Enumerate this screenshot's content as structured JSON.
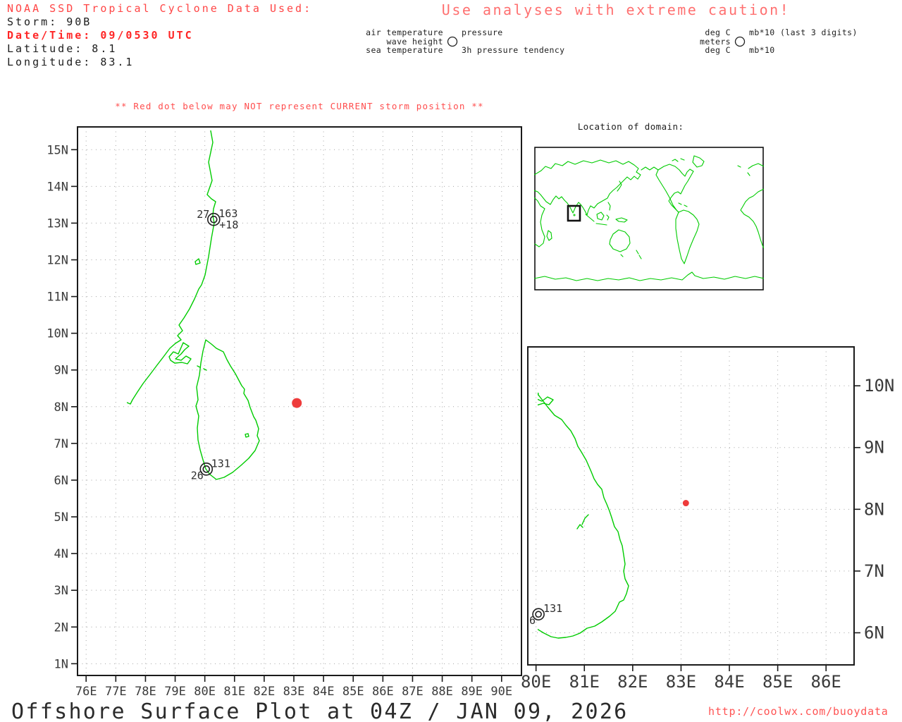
{
  "header": {
    "source_line": "NOAA SSD Tropical Cyclone Data Used:",
    "storm_line": "Storm: 90B",
    "datetime_line": "Date/Time: 09/0530 UTC",
    "latitude_line": "Latitude: 8.1",
    "longitude_line": "Longitude: 83.1",
    "caution": "Use analyses with extreme caution!"
  },
  "legend": {
    "air_label": "air temperature",
    "wave_label": "wave height",
    "sea_label": "sea temperature",
    "pressure_label": "pressure",
    "tendency_label": "3h pressure tendency",
    "air_unit": "deg C",
    "wave_unit": "meters",
    "sea_unit": "deg C",
    "pressure_unit": "mb*10 (last 3 digits)",
    "tendency_unit": "mb*10"
  },
  "warning": "** Red dot below may NOT represent CURRENT storm position **",
  "inset_title": "Location of domain:",
  "footer": {
    "title": "Offshore Surface Plot at 04Z / JAN 09, 2026",
    "url": "http://coolwx.com/buoydata"
  },
  "colors": {
    "coastline_green": "#00cc00",
    "storm_dot_red": "#ee3b3b",
    "warning_red": "#ff4d4d",
    "caution_red": "#ff7070",
    "header_red": "#ff4545",
    "datetime_red": "#ff2626",
    "url_red": "#ff5353",
    "grid_gray": "#a4a4a4",
    "axis_black": "#1a1a1a"
  },
  "chart_data": {
    "type": "map-observation-plot",
    "title": "Offshore Surface Plot at 04Z / JAN 09, 2026",
    "main_plot": {
      "x_tick_labels": [
        "76E",
        "77E",
        "78E",
        "79E",
        "80E",
        "81E",
        "82E",
        "83E",
        "84E",
        "85E",
        "86E",
        "87E",
        "88E",
        "89E",
        "90E"
      ],
      "y_tick_labels": [
        "1N",
        "2N",
        "3N",
        "4N",
        "5N",
        "6N",
        "7N",
        "8N",
        "9N",
        "10N",
        "11N",
        "12N",
        "13N",
        "14N",
        "15N"
      ],
      "lon_range": [
        75.71,
        90.67
      ],
      "lat_range": [
        0.68,
        15.62
      ],
      "grid": "dotted"
    },
    "zoom_plot": {
      "x_tick_labels": [
        "80E",
        "81E",
        "82E",
        "83E",
        "84E",
        "85E",
        "86E"
      ],
      "y_tick_labels": [
        "6N",
        "7N",
        "8N",
        "9N",
        "10N"
      ],
      "lon_range": [
        79.83,
        86.58
      ],
      "lat_range": [
        5.48,
        10.63
      ],
      "grid": "dotted"
    },
    "stations": [
      {
        "lon": 80.3,
        "lat": 13.1,
        "air_temp": "27",
        "pressure": "163",
        "pressure_tendency": "+18"
      },
      {
        "lon": 80.05,
        "lat": 6.3,
        "sea_temp": "26",
        "pressure": "131"
      }
    ],
    "storm_position": {
      "lon": 83.1,
      "lat": 8.1
    }
  }
}
